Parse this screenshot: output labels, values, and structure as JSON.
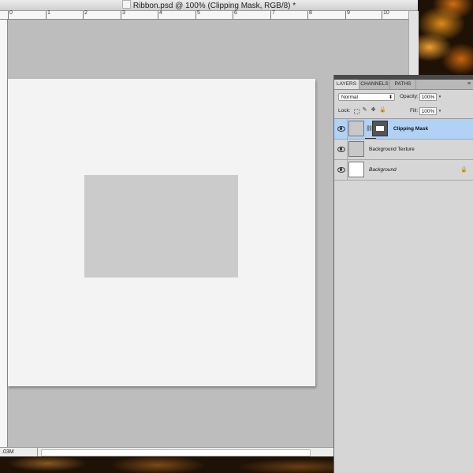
{
  "document": {
    "title": "Ribbon.psd @ 100% (Clipping Mask, RGB/8) *",
    "ruler_numbers": [
      "0",
      "1",
      "2",
      "3",
      "4",
      "5",
      "6",
      "7",
      "8",
      "9",
      "10"
    ],
    "status_text": ".03M"
  },
  "layers_panel": {
    "tabs": [
      "LAYERS",
      "CHANNELS",
      "PATHS"
    ],
    "active_tab": "LAYERS",
    "blend_mode": "Normal",
    "opacity_label": "Opacity:",
    "opacity_value": "100%",
    "lock_label": "Lock:",
    "fill_label": "Fill:",
    "fill_value": "100%",
    "layers": [
      {
        "name": "Clipping Mask",
        "selected": true,
        "has_mask": true
      },
      {
        "name": "Background Texture",
        "selected": false
      },
      {
        "name": "Background",
        "selected": false,
        "locked": true
      }
    ]
  },
  "colors": {
    "selection": "#b2d2f5",
    "canvas": "#f3f3f3",
    "clip_rect": "#cbcbcb"
  }
}
